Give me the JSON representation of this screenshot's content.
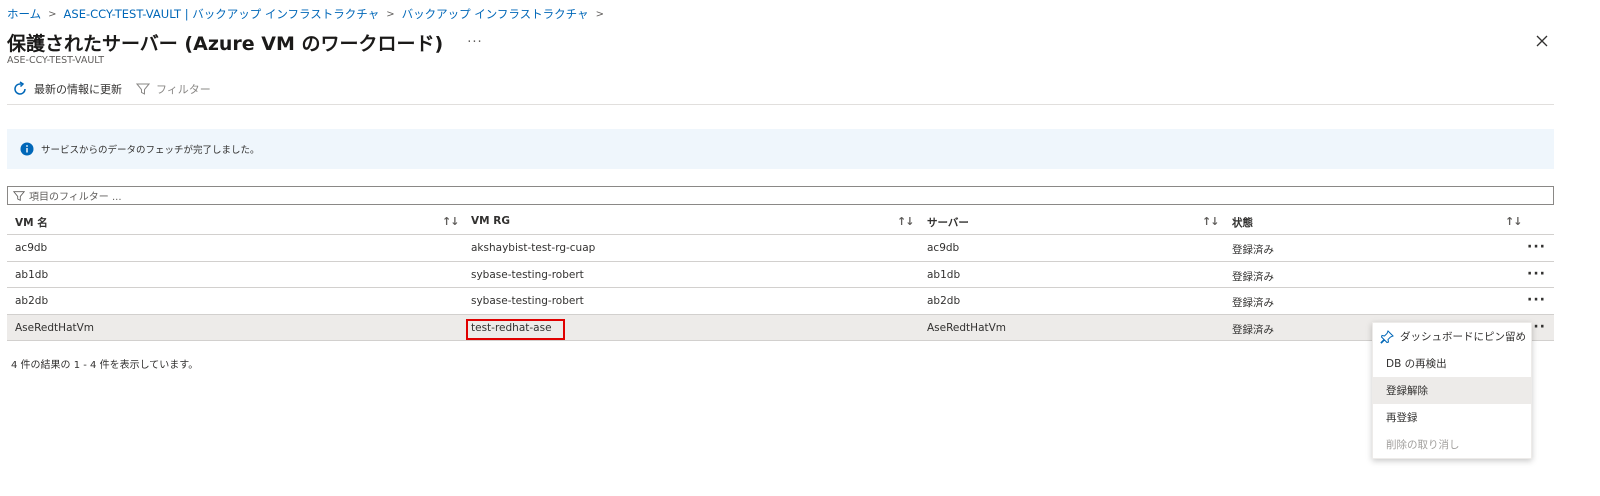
{
  "breadcrumb": {
    "items": [
      "ホーム",
      "ASE-CCY-TEST-VAULT | バックアップ インフラストラクチャ",
      "バックアップ インフラストラクチャ"
    ],
    "separator": ">"
  },
  "header": {
    "title": "保護されたサーバー (Azure VM のワークロード)",
    "more": "···",
    "subtitle": "ASE-CCY-TEST-VAULT",
    "close_icon": "close-icon"
  },
  "toolbar": {
    "refresh_label": "最新の情報に更新",
    "refresh_icon": "refresh-icon",
    "filter_label": "フィルター",
    "filter_icon": "filter-icon"
  },
  "info": {
    "message": "サービスからのデータのフェッチが完了しました。",
    "icon": "info-icon",
    "background": "#eff6fc"
  },
  "filter": {
    "placeholder": "項目のフィルター ..."
  },
  "table": {
    "columns": [
      "VM 名",
      "VM RG",
      "サーバー",
      "状態"
    ],
    "sort_glyph": "↑↓",
    "rows": [
      {
        "vm": "ac9db",
        "rg": "akshaybist-test-rg-cuap",
        "server": "ac9db",
        "state": "登録済み"
      },
      {
        "vm": "ab1db",
        "rg": "sybase-testing-robert",
        "server": "ab1db",
        "state": "登録済み"
      },
      {
        "vm": "ab2db",
        "rg": "sybase-testing-robert",
        "server": "ab2db",
        "state": "登録済み"
      },
      {
        "vm": "AseRedtHatVm",
        "rg": "test-redhat-ase",
        "server": "AseRedtHatVm",
        "state": "登録済み"
      }
    ],
    "row_more": "···"
  },
  "results_text": "4 件の結果の 1 - 4 件を表示しています。",
  "context_menu": {
    "items": [
      {
        "label": "ダッシュボードにピン留め",
        "icon": "pin-icon"
      },
      {
        "label": "DB の再検出"
      },
      {
        "label": "登録解除"
      },
      {
        "label": "再登録"
      },
      {
        "label": "削除の取り消し"
      }
    ]
  },
  "colors": {
    "link": "#0067b8",
    "highlight_border": "#e00000",
    "selected_row": "#edebe9"
  }
}
